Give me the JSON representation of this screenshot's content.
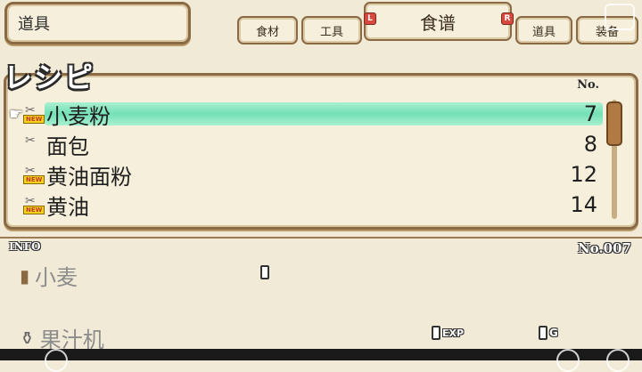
{
  "header": {
    "category": "道具",
    "tabs": [
      {
        "label": "食材"
      },
      {
        "label": "工具"
      },
      {
        "label": "食谱"
      },
      {
        "label": "道具"
      },
      {
        "label": "装备"
      }
    ],
    "left_trigger": "L",
    "right_trigger": "R"
  },
  "recipes": {
    "title": "レシピ",
    "no_header": "No.",
    "new_badge": "NEW",
    "items": [
      {
        "name": "小麦粉",
        "number": "7",
        "is_new": true,
        "selected": true
      },
      {
        "name": "面包",
        "number": "8",
        "is_new": false,
        "selected": false
      },
      {
        "name": "黄油面粉",
        "number": "12",
        "is_new": true,
        "selected": false
      },
      {
        "name": "黄油",
        "number": "14",
        "is_new": true,
        "selected": false
      }
    ]
  },
  "info": {
    "label": "INFO",
    "number": "No.007",
    "ingredient": "小麦",
    "tool": "果汁机",
    "exp_label": "EXP",
    "gold_label": "G"
  }
}
